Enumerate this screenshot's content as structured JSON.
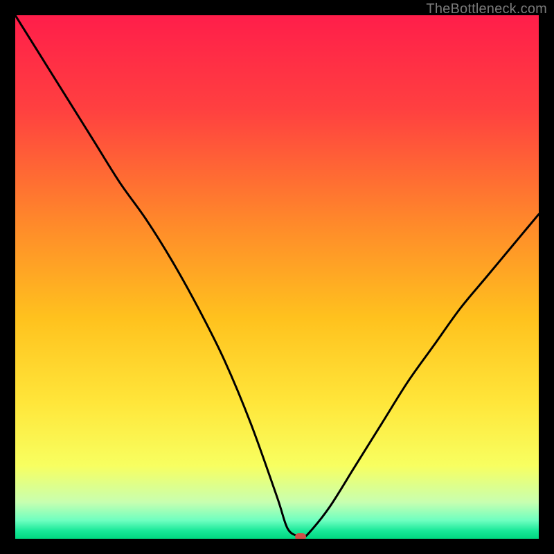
{
  "attribution": "TheBottleneck.com",
  "chart_data": {
    "type": "line",
    "title": "",
    "xlabel": "",
    "ylabel": "",
    "xlim": [
      0,
      100
    ],
    "ylim": [
      0,
      100
    ],
    "background_gradient": {
      "stops": [
        {
          "offset": 0.0,
          "color": "#ff1e4a"
        },
        {
          "offset": 0.18,
          "color": "#ff4040"
        },
        {
          "offset": 0.4,
          "color": "#ff8a2a"
        },
        {
          "offset": 0.58,
          "color": "#ffc21e"
        },
        {
          "offset": 0.74,
          "color": "#ffe63a"
        },
        {
          "offset": 0.86,
          "color": "#f8ff60"
        },
        {
          "offset": 0.93,
          "color": "#c8ffb0"
        },
        {
          "offset": 0.965,
          "color": "#6effc0"
        },
        {
          "offset": 0.985,
          "color": "#18e898"
        },
        {
          "offset": 1.0,
          "color": "#00d880"
        }
      ]
    },
    "curve": {
      "x": [
        0,
        5,
        10,
        15,
        20,
        25,
        30,
        35,
        40,
        45,
        50,
        52,
        54,
        55,
        56,
        60,
        65,
        70,
        75,
        80,
        85,
        90,
        95,
        100
      ],
      "y": [
        100,
        92,
        84,
        76,
        68,
        61,
        53,
        44,
        34,
        22,
        8,
        2,
        0.5,
        0.5,
        1,
        6,
        14,
        22,
        30,
        37,
        44,
        50,
        56,
        62
      ]
    },
    "marker": {
      "x": 54.5,
      "y": 0.4,
      "color": "#d05048"
    }
  }
}
